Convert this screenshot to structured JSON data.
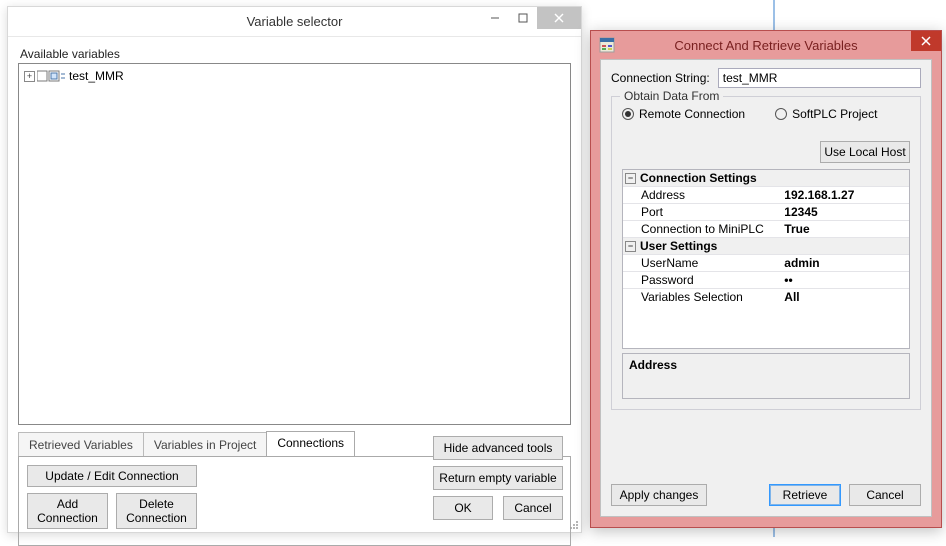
{
  "win1": {
    "title": "Variable selector",
    "avail_label": "Available variables",
    "tree": {
      "root_label": "test_MMR"
    },
    "tabs": {
      "retrieved": "Retrieved Variables",
      "in_project": "Variables in Project",
      "connections": "Connections"
    },
    "conn_tab": {
      "update": "Update / Edit Connection",
      "add": "Add Connection",
      "delete": "Delete Connection"
    },
    "right_buttons": {
      "hide": "Hide advanced tools",
      "return_empty": "Return empty variable",
      "ok": "OK",
      "cancel": "Cancel"
    }
  },
  "win2": {
    "title": "Connect And Retrieve Variables",
    "conn_string_label": "Connection String:",
    "conn_string_value": "test_MMR",
    "group_legend": "Obtain Data From",
    "radio_remote": "Remote Connection",
    "radio_softplc": "SoftPLC Project",
    "use_local_host": "Use Local Host",
    "propgrid": {
      "cat_conn": "Connection Settings",
      "address_label": "Address",
      "address_value": "192.168.1.27",
      "port_label": "Port",
      "port_value": "12345",
      "miniplc_label": "Connection to MiniPLC",
      "miniplc_value": "True",
      "cat_user": "User Settings",
      "username_label": "UserName",
      "username_value": "admin",
      "password_label": "Password",
      "password_value": "••",
      "varsel_label": "Variables Selection",
      "varsel_value": "All"
    },
    "desc_title": "Address",
    "buttons": {
      "apply": "Apply changes",
      "retrieve": "Retrieve",
      "cancel": "Cancel"
    }
  }
}
